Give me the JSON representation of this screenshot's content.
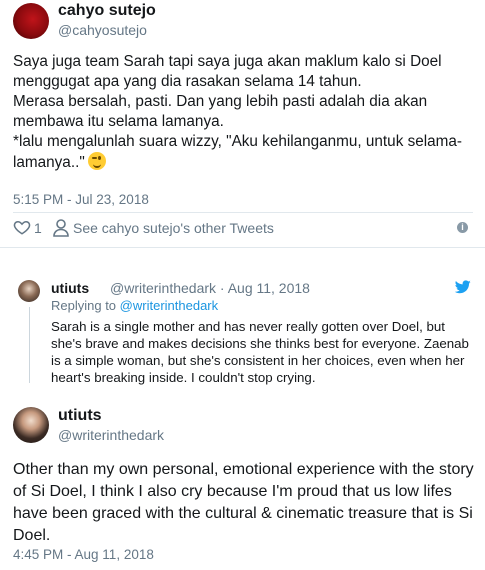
{
  "tweet1": {
    "name": "cahyo sutejo",
    "handle": "@cahyosutejo",
    "lines": [
      "Saya juga team Sarah tapi saya juga akan maklum kalo si Doel menggugat apa yang dia rasakan selama 14 tahun.",
      "Merasa bersalah, pasti. Dan yang lebih pasti adalah dia akan membawa itu selama lamanya.",
      "*lalu mengalunlah suara wizzy, \"Aku kehilanganmu, untuk selama-lamanya..\""
    ],
    "emoji": "winking-face",
    "timestamp": "5:15 PM - Jul 23, 2018",
    "like_count": "1",
    "see_tweets": "See cahyo sutejo's other Tweets",
    "info_glyph": "i"
  },
  "quoted": {
    "name": "utiuts",
    "meta": "@writerinthedark · Aug 11, 2018",
    "reply_prefix": "Replying to",
    "reply_handle": "@writerinthedark",
    "text": "Sarah is a single mother and has never really gotten over Doel, but she's brave and makes decisions she thinks best for everyone. Zaenab is a simple woman, but she's consistent in her choices, even when her heart's breaking inside. I couldn't stop crying."
  },
  "tweet2": {
    "name": "utiuts",
    "handle": "@writerinthedark",
    "text": "Other than my own personal, emotional experience with the story of Si Doel, I think I also cry because I'm proud that us low lifes have been graced with the cultural & cinematic treasure that is Si Doel.",
    "timestamp": "4:45 PM - Aug 11, 2018"
  },
  "colors": {
    "text": "#14171a",
    "muted": "#657786",
    "link": "#1b95e0",
    "twitter_blue": "#1da1f2",
    "border": "#e1e8ed"
  }
}
